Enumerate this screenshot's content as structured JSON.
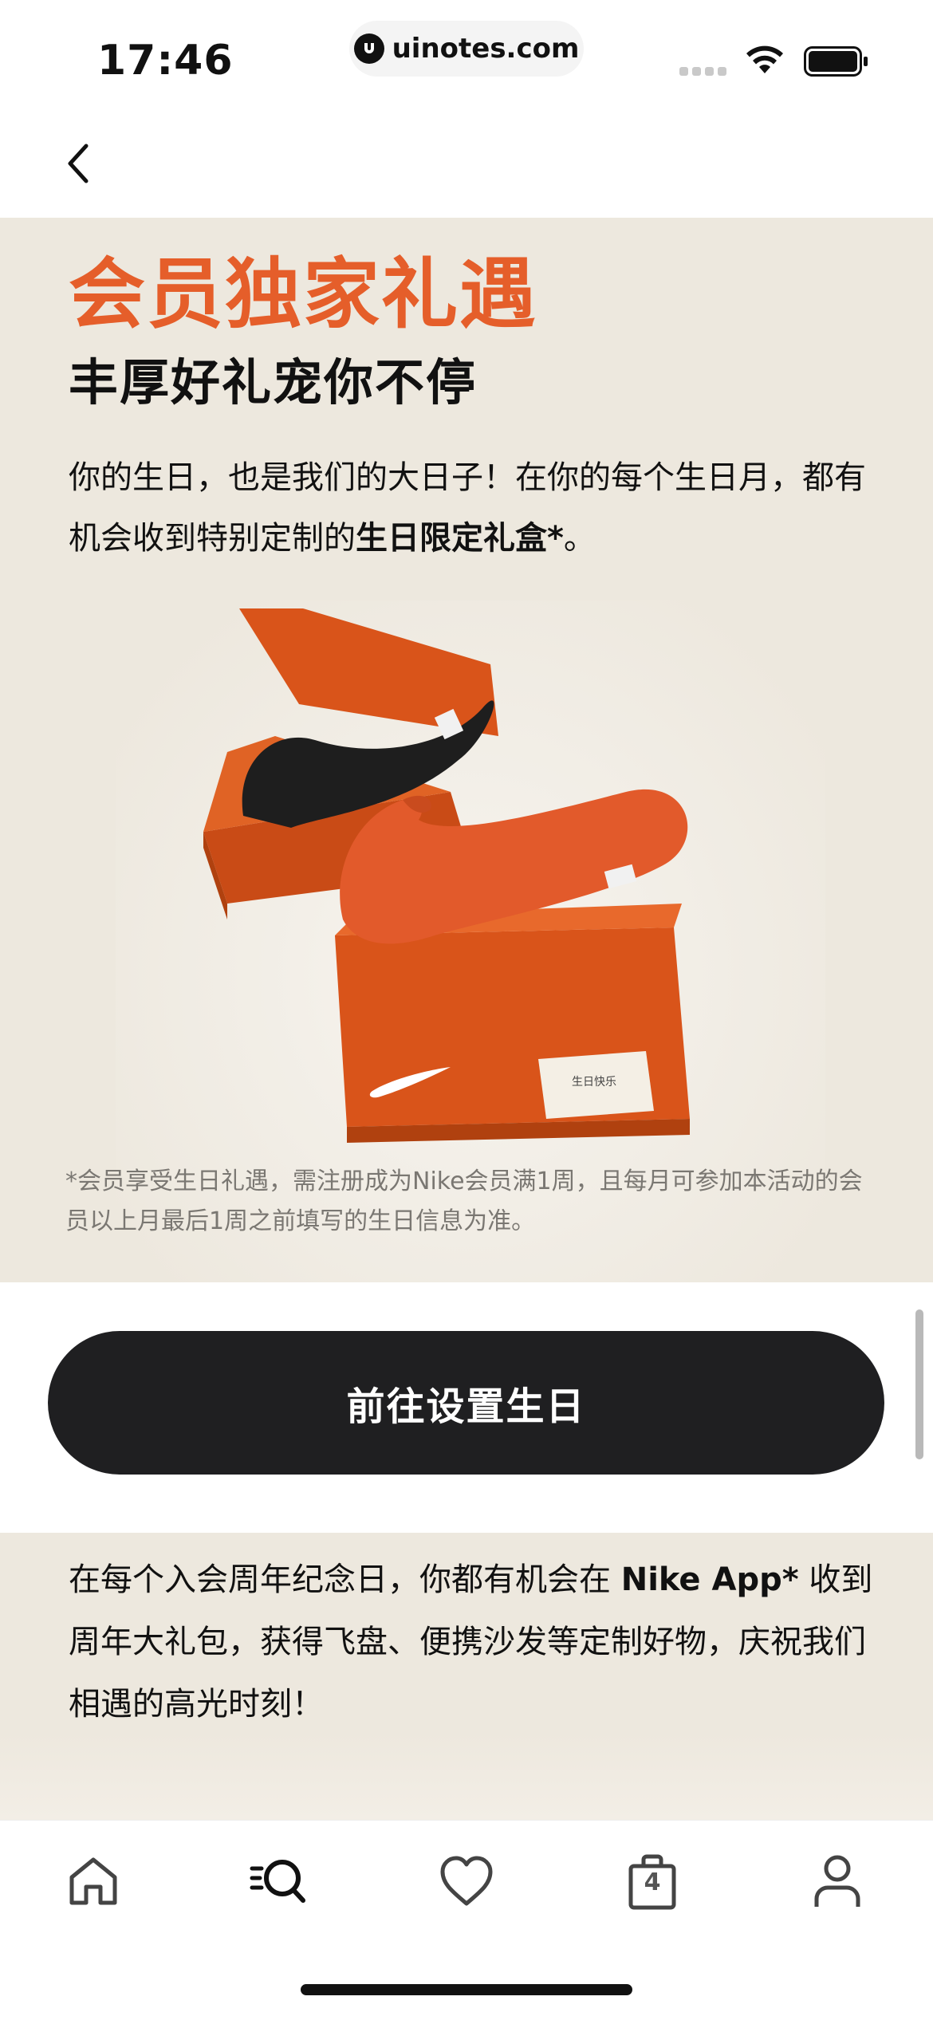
{
  "status_bar": {
    "time": "17:46",
    "url": "uinotes.com",
    "icons": [
      "signal-icon",
      "wifi-icon",
      "battery-icon"
    ]
  },
  "nav": {
    "back_icon": "chevron-left-icon"
  },
  "promo": {
    "title": "会员独家礼遇",
    "subtitle": "丰厚好礼宠你不停",
    "body_part1": "你的生日，也是我们的大日子！在你的每个生日月，都有机会收到特别定制的",
    "body_bold": "生日限定礼盒*",
    "body_part2": "。",
    "box_card_text": "生日快乐",
    "footnote": "*会员享受生日礼遇，需注册成为Nike会员满1周，且每月可参加本活动的会员以上月最后1周之前填写的生日信息为准。"
  },
  "cta": {
    "label": "前往设置生日"
  },
  "anniversary": {
    "part1": "在每个入会周年纪念日，你都有机会在 ",
    "bold": "Nike App*",
    "part2": " 收到周年大礼包，获得飞盘、便携沙发等定制好物，庆祝我们相遇的高光时刻！"
  },
  "tab_bar": {
    "items": [
      "home-icon",
      "search-icon",
      "heart-icon",
      "bag-icon",
      "profile-icon"
    ],
    "bag_count": "4"
  },
  "colors": {
    "accent": "#e55e2a",
    "cream": "#ede8de",
    "button": "#1f1f21"
  }
}
